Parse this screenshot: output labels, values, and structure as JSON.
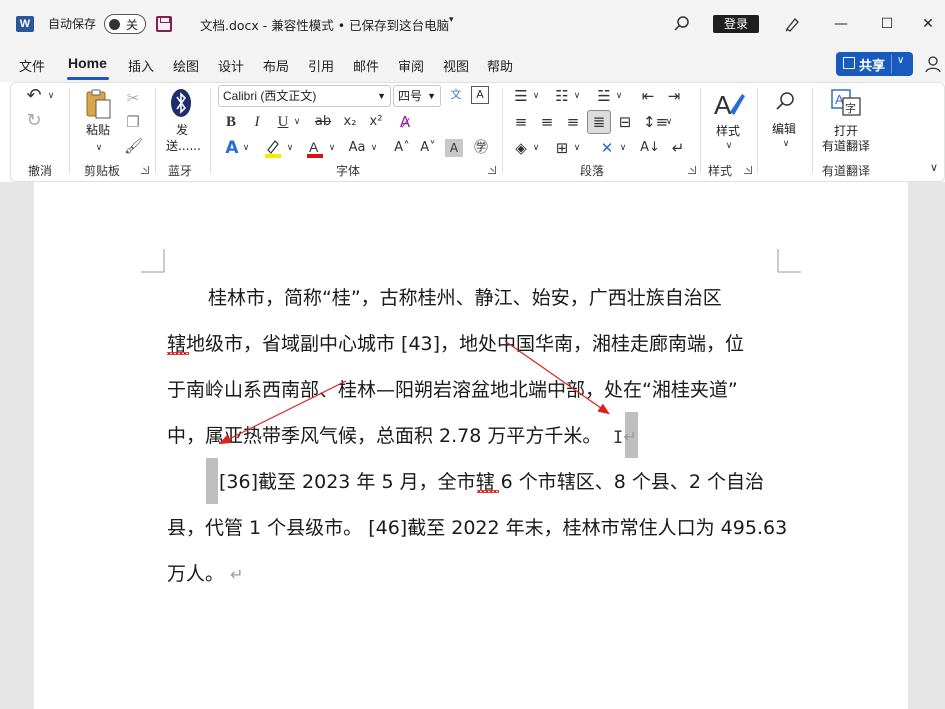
{
  "titlebar": {
    "app_logo": "W",
    "autosave_label": "自动保存",
    "autosave_state": "关",
    "doc_title": "文档.docx  -  兼容性模式 • 已保存到这台电脑",
    "login_label": "登录",
    "minimize": "—",
    "maximize": "☐",
    "close": "✕"
  },
  "tabs": [
    "文件",
    "Home",
    "插入",
    "绘图",
    "设计",
    "布局",
    "引用",
    "邮件",
    "审阅",
    "视图",
    "帮助"
  ],
  "share_label": "共享",
  "ribbon": {
    "undo_group": "撤消",
    "clipboard": {
      "paste": "粘贴",
      "group": "剪贴板"
    },
    "bluetooth": {
      "send": "发",
      "send2": "送......",
      "group": "蓝牙"
    },
    "font": {
      "name": "Calibri (西文正文)",
      "size": "四号",
      "bold": "B",
      "italic": "I",
      "underline": "U",
      "strike": "ab",
      "sub": "x₂",
      "sup": "x²",
      "group": "字体"
    },
    "paragraph_group": "段落",
    "styles": {
      "label": "样式",
      "group": "样式"
    },
    "editing": {
      "label": "编辑"
    },
    "youdao": {
      "line1": "打开",
      "line2": "有道翻译",
      "group": "有道翻译"
    }
  },
  "document": {
    "lines": [
      "桂林市，简称“桂”，古称桂州、静江、始安，广西壮族自治区",
      "辖地级市，省域副中心城市  [43]，地处中国华南，湘桂走廊南端，位",
      "于南岭山系西南部、桂林—阳朔岩溶盆地北端中部，处在“湘桂夹道”",
      "中，属亚热带季风气候，总面积 2.78 万平方千米。",
      "[36]截至 2023 年 5 月，全市辖 6 个市辖区、8 个县、2 个自治",
      "县，代管 1 个县级市。 [46]截至 2022 年末，桂林市常住人口为 495.63",
      "万人。"
    ],
    "para_mark": "↵"
  },
  "colors": {
    "accent": "#185abd",
    "arrow": "#e0201b"
  }
}
